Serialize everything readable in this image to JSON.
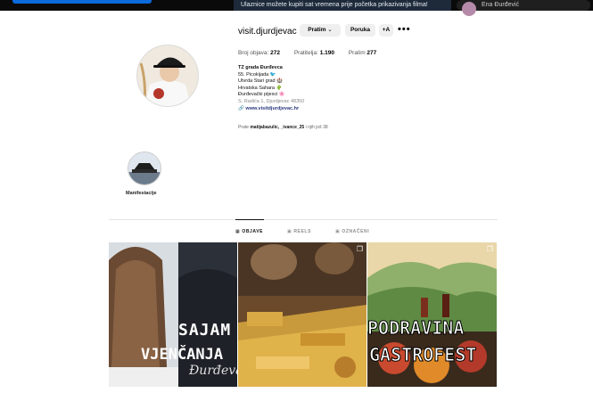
{
  "browser": {
    "banner_text": "Ulaznice možete kupiti sat vremena prije početka prikazivanja filma!",
    "user_name": "Ena Đurđević"
  },
  "profile": {
    "username": "visit.djurdjevac",
    "follow_label": "Pratim",
    "message_label": "Poruka",
    "add_user_icon_text": "+A",
    "more_label": "•••",
    "stats": {
      "posts_label": "Broj objava:",
      "posts_value": "272",
      "followers_label": "Pratitelja:",
      "followers_value": "1.190",
      "following_label": "Pratim",
      "following_value": "277"
    },
    "bio": {
      "name": "TZ grada Đurđevca",
      "lines": [
        "55. Picokijada 🐦",
        "Utvrda Stari grad 🏰",
        "Hrvatska Sahara 🌵",
        "Đurđevački pijesci 🌸"
      ],
      "address": "S. Radića 1, Djurdjevac 48350",
      "link": "www.visitdjurdjevac.hr"
    },
    "followed_by": {
      "prefix": "Prate",
      "users": "matijabazulic, _ivance_25",
      "suffix": "i njih još 38"
    }
  },
  "highlights": [
    {
      "label": "Manifestacije"
    }
  ],
  "tabs": [
    {
      "label": "OBJAVE",
      "icon": "grid-icon"
    },
    {
      "label": "REELS",
      "icon": "reels-icon"
    },
    {
      "label": "OZNAČENI",
      "icon": "tagged-icon"
    }
  ],
  "posts": [
    {
      "overlay_line1": "SAJAM",
      "overlay_line2": "VJENČANJA",
      "script": "Đurđevac"
    },
    {
      "overlay_line1": ""
    },
    {
      "overlay_line1": "PODRAVINA",
      "overlay_line2": "GASTROFEST"
    }
  ]
}
